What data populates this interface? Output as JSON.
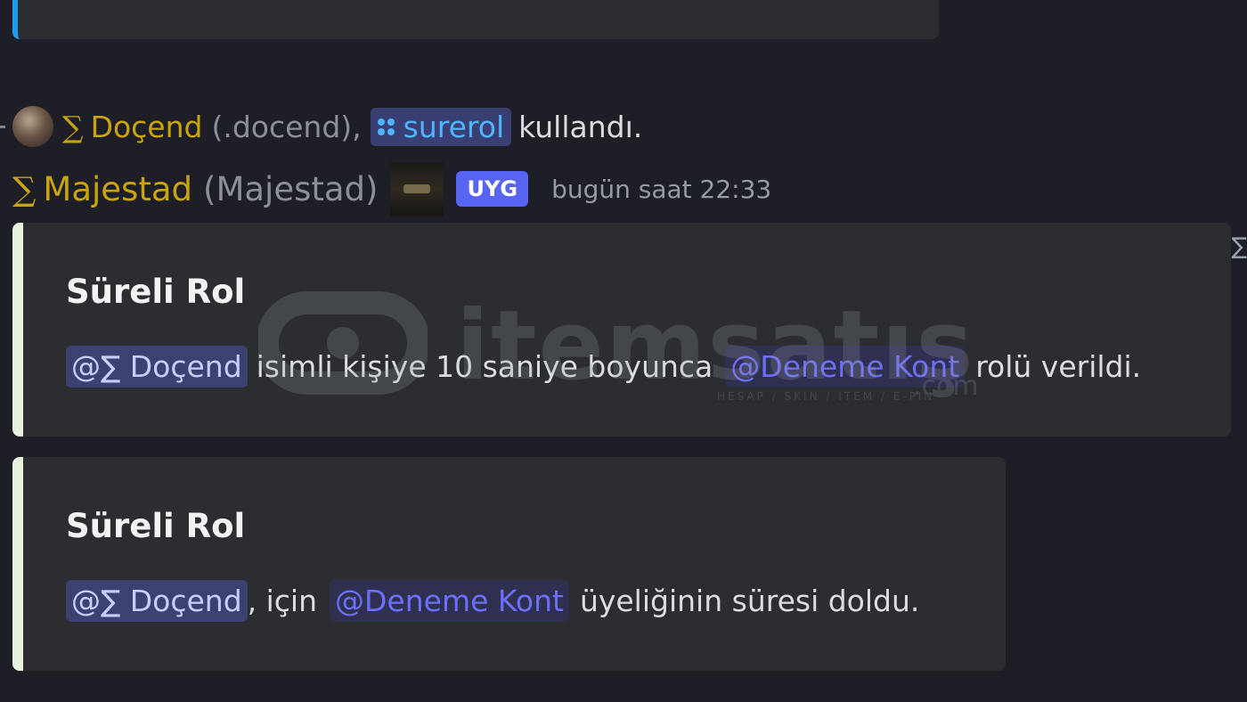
{
  "reply": {
    "user_sigma": "∑",
    "user_name": "Doçend",
    "user_tag": "(.docend),",
    "command": "surerol",
    "action_text": "kullandı."
  },
  "author": {
    "sigma": "∑",
    "name": "Majestad",
    "handle": "(Majestad)",
    "badge": "UYG",
    "timestamp": "bugün saat 22:33"
  },
  "embeds": [
    {
      "title": "Süreli Rol",
      "mention": "@∑ Doçend",
      "text_a": "isimli kişiye 10 saniye boyunca",
      "role": "@Deneme Kont",
      "text_b": "rolü verildi."
    },
    {
      "title": "Süreli Rol",
      "mention": "@∑ Doçend",
      "text_a": ", için",
      "role": "@Deneme Kont",
      "text_b": "üyeliğinin süresi doldu."
    }
  ],
  "watermark": {
    "brand": "itemsatış",
    "tagline": "HESAP / SKIN / ITEM / E-PIN",
    "suffix": ".com"
  },
  "colors": {
    "background": "#1e1f26",
    "embed_bg": "#2b2d31",
    "embed_border": "#e9f2dc",
    "gold": "#c9a40e",
    "command_blue": "#4fb3ff",
    "app_badge": "#5865f2",
    "role_mention": "#6c6ff7"
  },
  "edge_glyph": "∑"
}
